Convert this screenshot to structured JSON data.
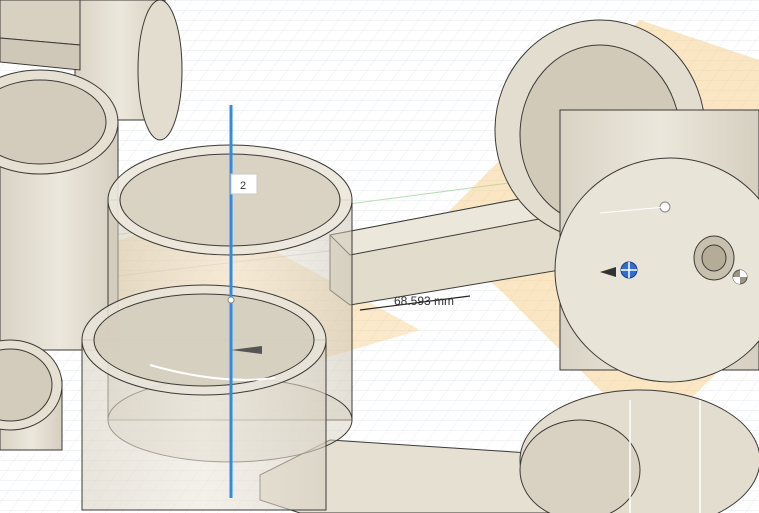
{
  "viewport": {
    "background": "#ffffff",
    "grid_color": "#dfe3ea",
    "body_color": "#e8e2d4",
    "edge_color": "#3c3a36",
    "plane_color": "#f5c77a"
  },
  "manipulator": {
    "axis_color": "#2f8be6",
    "value_label": "2"
  },
  "dimension": {
    "label": "68.593 mm"
  },
  "icons": {
    "pivot": "move-pivot-icon",
    "center": "center-point-icon",
    "origin": "origin-marker-icon"
  }
}
